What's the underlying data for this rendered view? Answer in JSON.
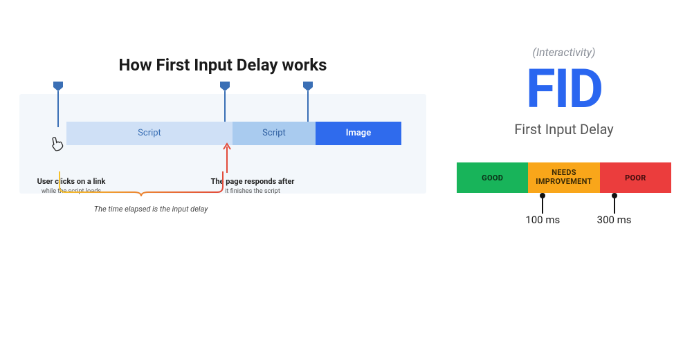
{
  "left": {
    "title": "How First Input Delay works",
    "segments": {
      "script1": "Script",
      "script2": "Script",
      "image": "Image"
    },
    "annotation_click": {
      "bold": "User clicks on a link",
      "small": "while the script loads"
    },
    "annotation_respond": {
      "bold": "The page responds after",
      "small": "it finishes the script"
    },
    "caption": "The time elapsed is the input delay"
  },
  "right": {
    "tag": "(Interactivity)",
    "acronym": "FID",
    "full": "First Input Delay",
    "bands": {
      "good": "GOOD",
      "needs": "NEEDS\nIMPROVEMENT",
      "poor": "POOR"
    },
    "ticks": {
      "t1": "100 ms",
      "t2": "300 ms"
    }
  },
  "colors": {
    "blue": "#2a66f0",
    "good": "#18b45a",
    "needs": "#f9a61a",
    "poor": "#eb3d3d"
  }
}
